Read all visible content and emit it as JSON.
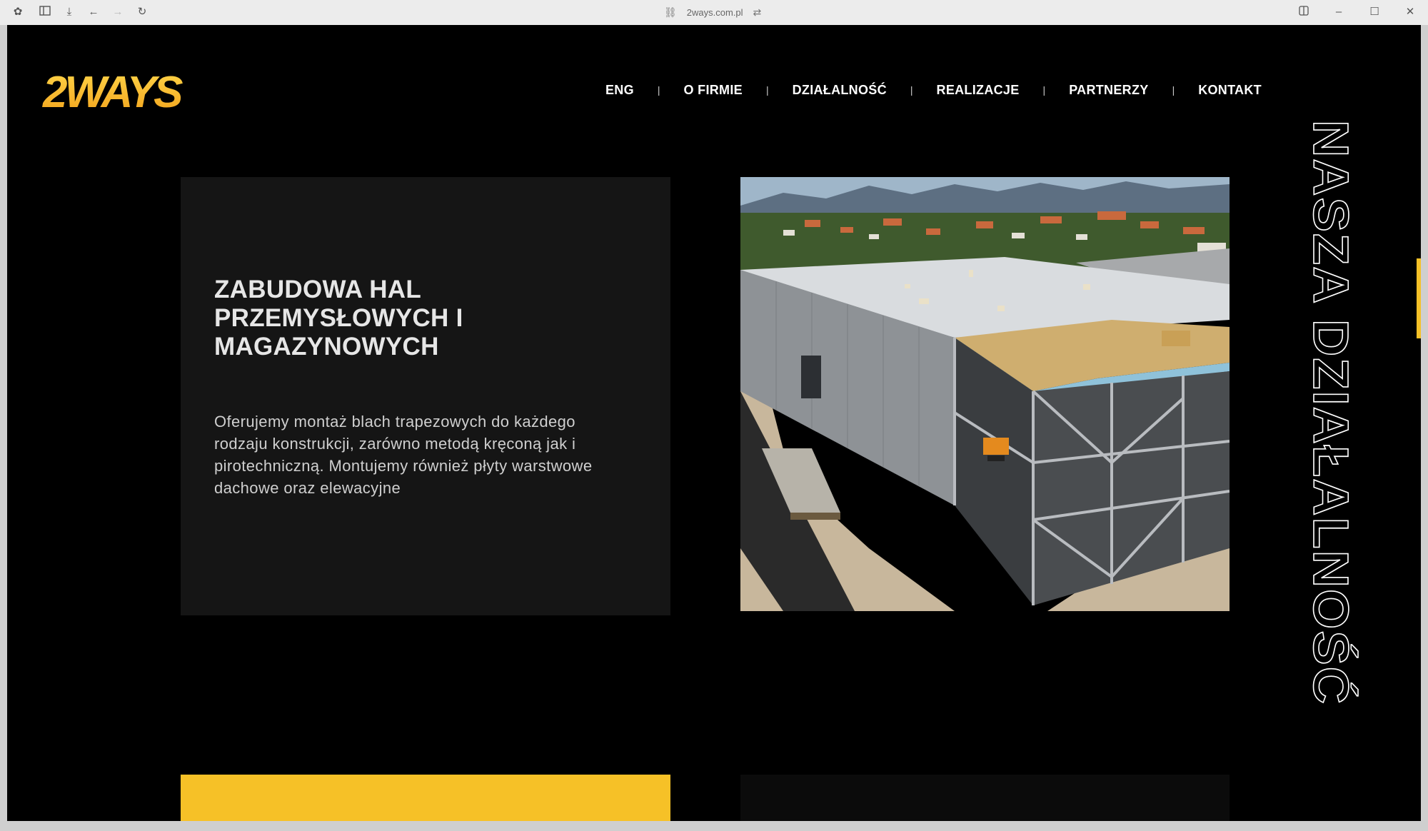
{
  "browser": {
    "url": "2ways.com.pl"
  },
  "brand": {
    "logo_text": "2WAYS",
    "accent_color": "#f6c127"
  },
  "nav": {
    "items": [
      "ENG",
      "O FIRMIE",
      "DZIAŁALNOŚĆ",
      "REALIZACJE",
      "PARTNERZY",
      "KONTAKT"
    ]
  },
  "section": {
    "vertical_title": "NASZA DZIAŁALNOŚĆ"
  },
  "card": {
    "title": "ZABUDOWA HAL PRZEMYSŁOWYCH I MAGAZYNOWYCH",
    "description": "Oferujemy montaż blach trapezowych do każdego rodzaju konstrukcji, zarówno metodą kręconą jak i pirotechniczną. Montujemy również płyty warstwowe dachowe oraz elewacyjne"
  },
  "icons": {
    "toolbar": [
      "extensions-icon",
      "sidebar-icon",
      "download-icon",
      "back-icon",
      "forward-icon",
      "reload-icon"
    ],
    "window": [
      "split-view-icon",
      "minimize-icon",
      "maximize-icon",
      "close-icon"
    ]
  }
}
